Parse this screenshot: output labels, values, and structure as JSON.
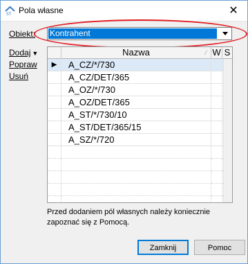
{
  "window": {
    "title": "Pola własne"
  },
  "form": {
    "object_label": "Obiekt:",
    "object_value": "Kontrahent"
  },
  "side_actions": {
    "add": "Dodaj",
    "edit": "Popraw",
    "delete": "Usuń"
  },
  "grid": {
    "columns": [
      "Nazwa",
      "W",
      "S"
    ],
    "rows": [
      {
        "name": "A_CZ/*/730",
        "w": false,
        "s": true,
        "selected": true
      },
      {
        "name": "A_CZ/DET/365",
        "w": false,
        "s": false,
        "selected": false
      },
      {
        "name": "A_OZ/*/730",
        "w": false,
        "s": true,
        "selected": false
      },
      {
        "name": "A_OZ/DET/365",
        "w": false,
        "s": false,
        "selected": false
      },
      {
        "name": "A_ST/*/730/10",
        "w": false,
        "s": true,
        "selected": false
      },
      {
        "name": "A_ST/DET/365/15",
        "w": false,
        "s": true,
        "selected": false
      },
      {
        "name": "A_SZ/*/720",
        "w": false,
        "s": false,
        "selected": false
      }
    ]
  },
  "info_text": "Przed dodaniem pól własnych należy koniecznie zapoznać się z Pomocą.",
  "buttons": {
    "close": "Zamknij",
    "help": "Pomoc"
  },
  "colors": {
    "selection": "#0078d7",
    "highlight_ellipse": "#e31e24",
    "check": "#8a8a8a"
  }
}
